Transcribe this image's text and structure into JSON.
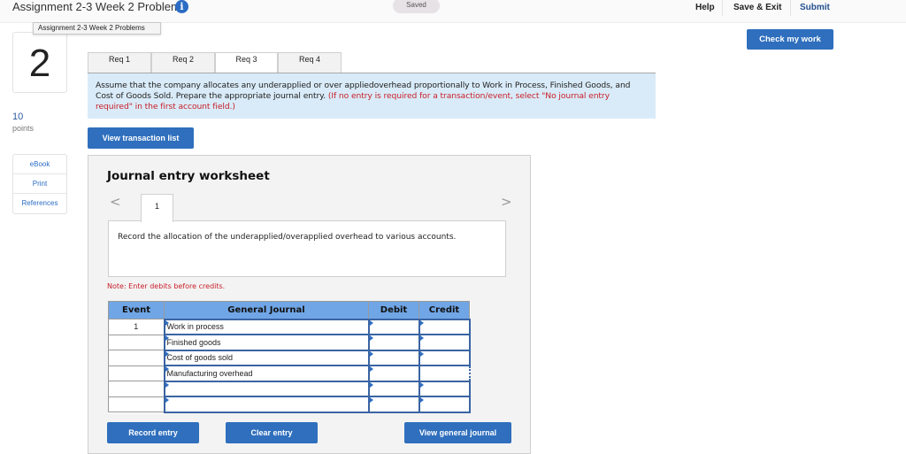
{
  "header": {
    "title": "Assignment 2-3 Week 2 Problems",
    "tooltip": "Assignment 2-3 Week 2 Problems",
    "status": "Saved",
    "links": {
      "help": "Help",
      "save_exit": "Save & Exit",
      "submit": "Submit"
    },
    "check_my_work": "Check my work"
  },
  "question": {
    "number": "2",
    "points_value": "10",
    "points_label": "points",
    "resources": [
      "eBook",
      "Print",
      "References"
    ]
  },
  "req_tabs": [
    {
      "label": "Req 1",
      "active": false
    },
    {
      "label": "Req 2",
      "active": false
    },
    {
      "label": "Req 3",
      "active": true
    },
    {
      "label": "Req 4",
      "active": false
    }
  ],
  "instructions": {
    "text": "Assume that the company allocates any underapplied or over appliedoverhead proportionally to Work in Process, Finished Goods, and Cost of Goods Sold. Prepare the appropriate journal entry. ",
    "note": "(If no entry is required for a transaction/event, select \"No journal entry required\" in the first account field.)"
  },
  "view_transaction_list": "View transaction list",
  "worksheet": {
    "title": "Journal entry worksheet",
    "entry_tab": "1",
    "description": "Record the allocation of the underapplied/overapplied overhead to various accounts.",
    "note": "Note: Enter debits before credits.",
    "columns": [
      "Event",
      "General Journal",
      "Debit",
      "Credit"
    ],
    "rows": [
      {
        "event": "1",
        "account": "Work in process",
        "debit": "",
        "credit": ""
      },
      {
        "event": "",
        "account": "Finished goods",
        "debit": "",
        "credit": ""
      },
      {
        "event": "",
        "account": "Cost of goods sold",
        "debit": "",
        "credit": ""
      },
      {
        "event": "",
        "account": "Manufacturing overhead",
        "debit": "",
        "credit": ""
      },
      {
        "event": "",
        "account": "",
        "debit": "",
        "credit": ""
      },
      {
        "event": "",
        "account": "",
        "debit": "",
        "credit": ""
      }
    ],
    "buttons": {
      "record": "Record entry",
      "clear": "Clear entry",
      "view_journal": "View general journal"
    }
  },
  "colors": {
    "accent": "#2f6fbd",
    "header_blue": "#70a6e6",
    "instr_bg": "#d9ebf8",
    "warning_red": "#c8202a"
  }
}
